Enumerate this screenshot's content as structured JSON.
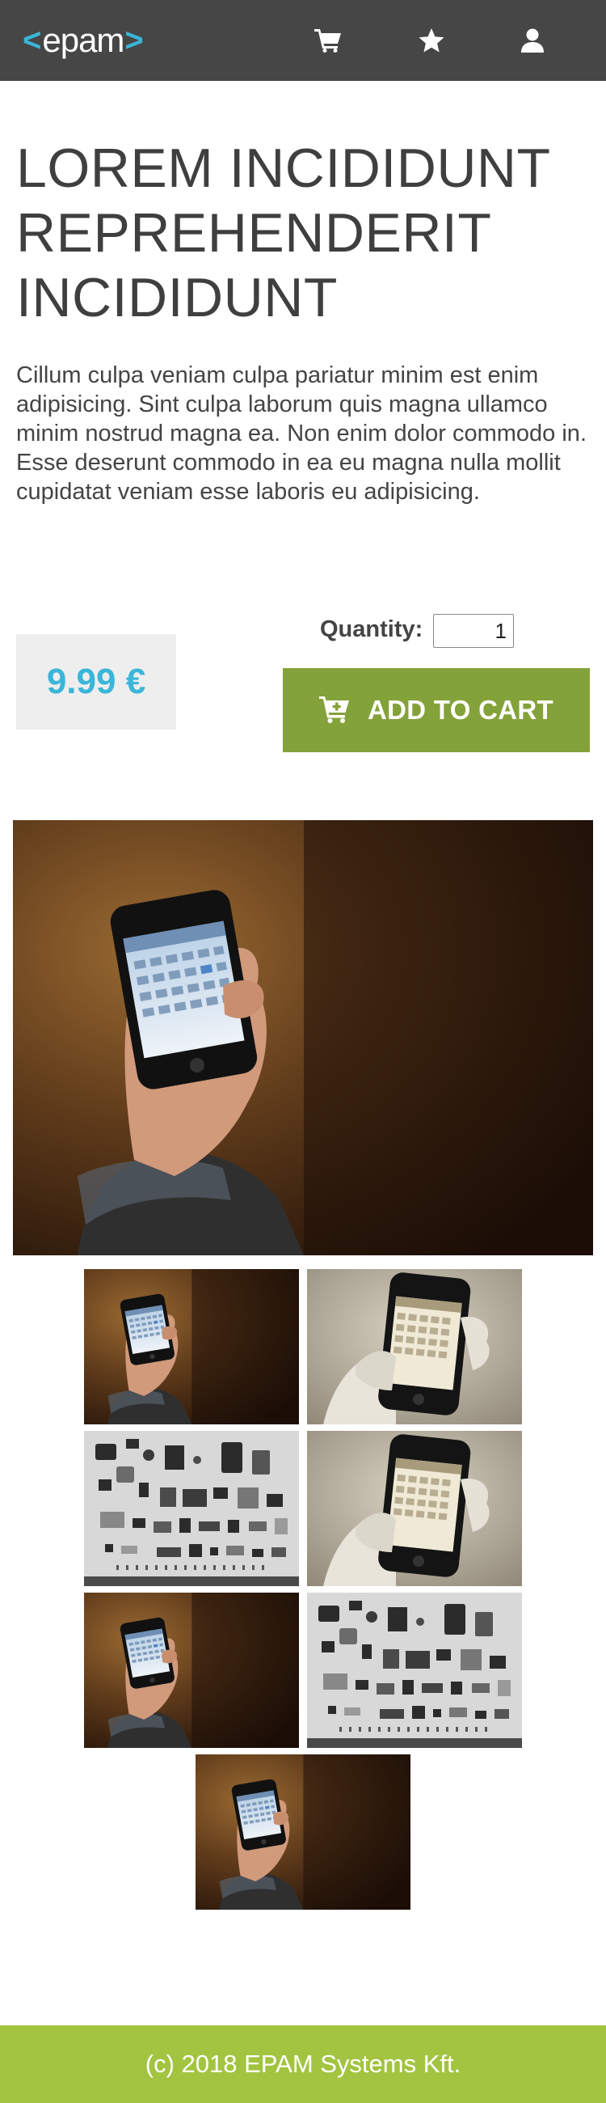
{
  "header": {
    "logo": {
      "left_bracket": "<",
      "word": "epam",
      "right_bracket": ">"
    },
    "nav": [
      {
        "name": "cart-icon"
      },
      {
        "name": "star-icon"
      },
      {
        "name": "user-icon"
      }
    ]
  },
  "product": {
    "title": "LOREM INCIDIDUNT REPREHENDERIT INCIDIDUNT",
    "description": "Cillum culpa veniam culpa pariatur minim est enim adipisicing. Sint culpa laborum quis magna ullamco minim nostrud magna ea. Non enim dolor commodo in. Esse deserunt commodo in ea eu magna nulla mollit cupidatat veniam esse laboris eu adipisicing.",
    "price": "9.99 €",
    "quantity_label": "Quantity:",
    "quantity_value": "1",
    "add_to_cart_label": "ADD TO CART",
    "add_to_cart_icon": "cart-plus-icon"
  },
  "gallery": {
    "main_image": "phone-in-hand-photo",
    "thumbnails": [
      "phone-in-hand-photo",
      "phone-calendar-sepia-photo",
      "disassembled-parts-photo",
      "phone-calendar-sepia-photo",
      "phone-in-hand-photo",
      "disassembled-parts-photo",
      "phone-in-hand-photo"
    ]
  },
  "footer": {
    "text": "(c) 2018 EPAM Systems Kft."
  },
  "colors": {
    "header_bg": "#464646",
    "logo_accent": "#39b6d8",
    "price_color": "#39b6d8",
    "button_bg": "#84a23a",
    "footer_bg": "#a2c440"
  }
}
